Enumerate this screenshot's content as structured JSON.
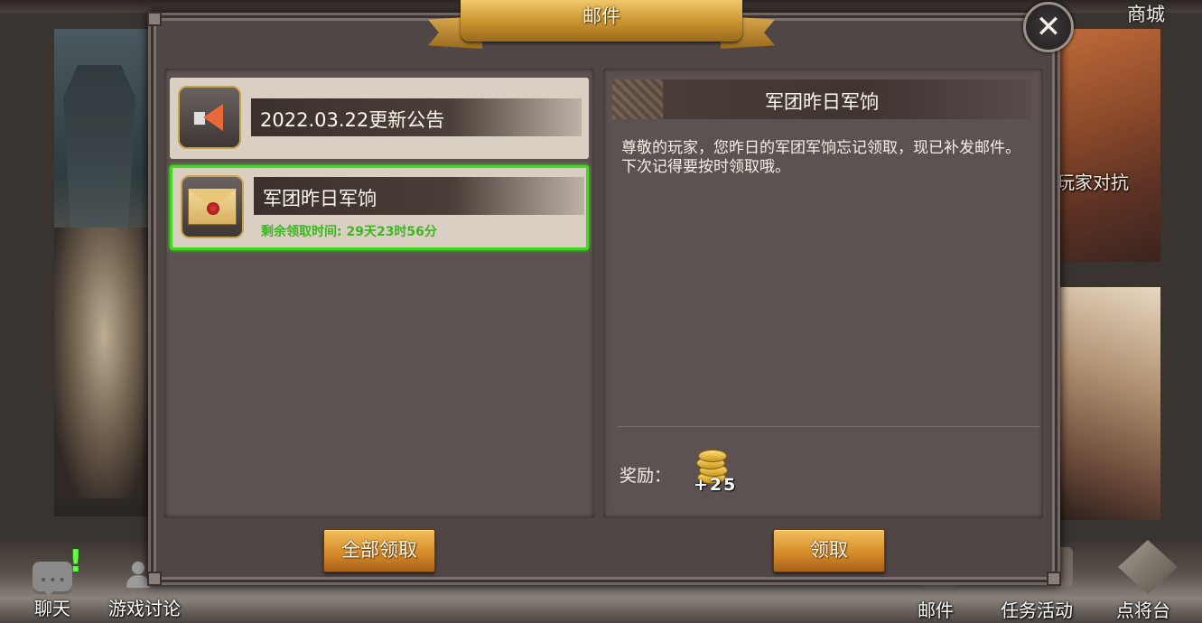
{
  "dialog": {
    "title": "邮件"
  },
  "mails": [
    {
      "title": "2022.03.22更新公告",
      "icon": "speaker-icon"
    },
    {
      "title": "军团昨日军饷",
      "icon": "envelope-icon",
      "remaining": "剩余领取时间: 29天23时56分"
    }
  ],
  "detail": {
    "title": "军团昨日军饷",
    "body": "尊敬的玩家，您昨日的军团军饷忘记领取，现已补发邮件。下次记得要按时领取哦。",
    "reward_label": "奖励：",
    "reward_icon": "gold-coin-icon",
    "reward_count": "+25"
  },
  "buttons": {
    "claim_all": "全部领取",
    "claim": "领取"
  },
  "close_icon": "close-icon",
  "background": {
    "top_right": "商城",
    "side_right": "玩家对抗",
    "bottom_left": [
      "聊天",
      "游戏讨论"
    ],
    "bottom_right": [
      "邮件",
      "任务活动",
      "点将台"
    ]
  },
  "colors": {
    "selected_border": "#3ddc1e",
    "remaining_text": "#3fb523",
    "button_gold": "#d68c2a"
  }
}
